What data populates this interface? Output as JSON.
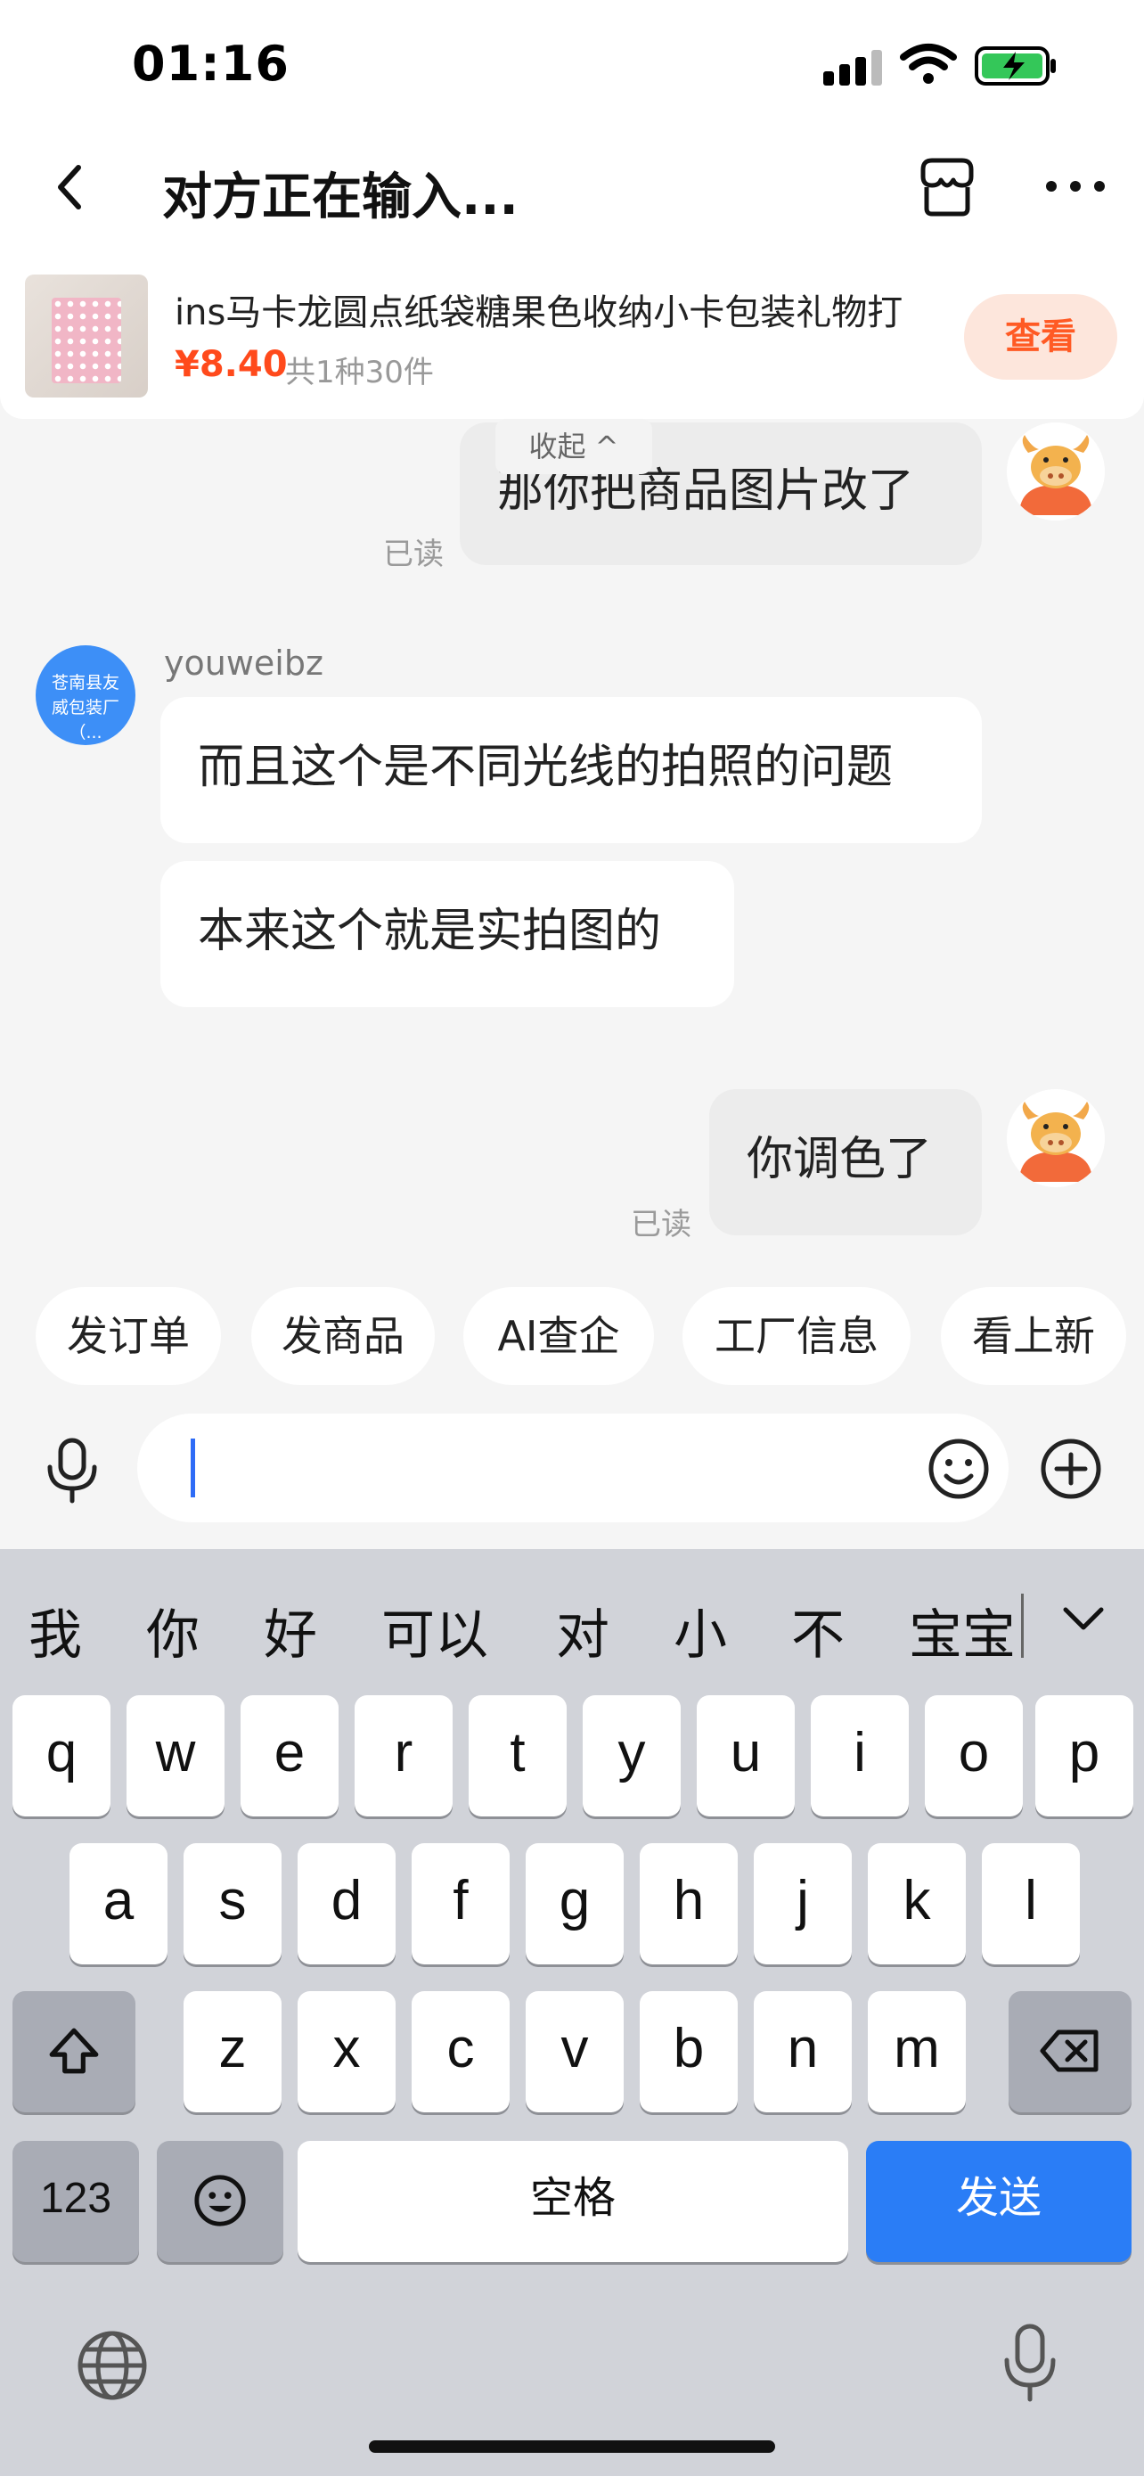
{
  "status_bar": {
    "time": "01:16"
  },
  "header": {
    "title": "对方正在输入..."
  },
  "product": {
    "name": "ins马卡龙圆点纸袋糖果色收纳小卡包装礼物打",
    "price": "¥8.40",
    "quantity": "共1种30件",
    "view_label": "查看"
  },
  "chat": {
    "collapse_label": "收起 ^",
    "messages": [
      {
        "from": "me",
        "text": "那你把商品图片改了",
        "status": "已读"
      },
      {
        "from": "other",
        "sender": "youweibz",
        "avatar_text": "苍南县友威包装厂（...",
        "text": "而且这个是不同光线的拍照的问题"
      },
      {
        "from": "other",
        "text": "本来这个就是实拍图的"
      },
      {
        "from": "me",
        "text": "你调色了",
        "status": "已读"
      }
    ]
  },
  "quick_actions": [
    "发订单",
    "发商品",
    "AI查企",
    "工厂信息",
    "看上新"
  ],
  "input": {
    "value": ""
  },
  "keyboard": {
    "candidates": [
      "我",
      "你",
      "好",
      "可以",
      "对",
      "小",
      "不",
      "宝宝"
    ],
    "row1": [
      "q",
      "w",
      "e",
      "r",
      "t",
      "y",
      "u",
      "i",
      "o",
      "p"
    ],
    "row2": [
      "a",
      "s",
      "d",
      "f",
      "g",
      "h",
      "j",
      "k",
      "l"
    ],
    "row3": [
      "z",
      "x",
      "c",
      "v",
      "b",
      "n",
      "m"
    ],
    "num_label": "123",
    "space_label": "空格",
    "send_label": "发送"
  },
  "colors": {
    "accent_price": "#ff4a1c",
    "send_key": "#2a7df6",
    "avatar_shop": "#3d8ff7"
  }
}
